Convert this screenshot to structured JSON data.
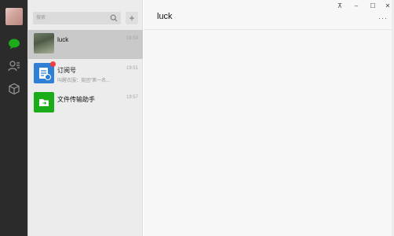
{
  "search": {
    "placeholder": "搜索"
  },
  "chats": [
    {
      "name": "luck",
      "time": "19:58",
      "preview": ""
    },
    {
      "name": "订阅号",
      "time": "19:51",
      "preview": "叫醒衣服：美团\"第一名..."
    },
    {
      "name": "文件传输助手",
      "time": "19:57",
      "preview": ""
    }
  ],
  "main": {
    "title": "luck",
    "more_label": "···"
  },
  "window": {
    "pin": "⊼",
    "minimize": "–",
    "maximize": "☐",
    "close": "✕"
  },
  "colors": {
    "rail": "#2b2b2b",
    "accent_green": "#1aad19",
    "active_item": "#c9c9c9"
  }
}
